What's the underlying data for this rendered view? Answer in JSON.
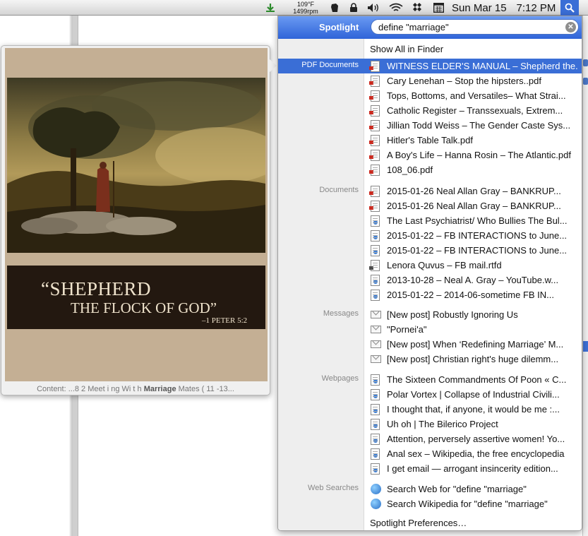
{
  "menubar": {
    "temp": "109°F",
    "rpm": "1499rpm",
    "day_date": "Sun Mar 15",
    "time": "7:12 PM"
  },
  "spotlight": {
    "label": "Spotlight",
    "query": "define \"marriage\"",
    "show_all": "Show All in Finder",
    "preferences": "Spotlight Preferences…"
  },
  "preview": {
    "cover_title_line1": "“SHEPHERD",
    "cover_title_line2": "THE FLOCK OF GOD”",
    "cover_reference": "–1 PETER 5:2",
    "content_prefix": "Content: ...8 2 Meet i ng Wi t h ",
    "content_match": "Marriage",
    "content_suffix": " Mates ( 11 -13..."
  },
  "categories": {
    "pdf": "PDF Documents",
    "documents": "Documents",
    "messages": "Messages",
    "webpages": "Webpages",
    "web_searches": "Web Searches"
  },
  "results": {
    "pdf": [
      "WITNESS ELDER'S MANUAL – Shepherd the...",
      "Cary Lenehan – Stop the hipsters..pdf",
      "Tops, Bottoms, and Versatiles– What Strai...",
      "Catholic Register – Transsexuals, Extrem...",
      "Jillian Todd Weiss – The Gender Caste Sys...",
      "Hitler's Table Talk.pdf",
      "A Boy's Life – Hanna Rosin – The Atlantic.pdf",
      "108_06.pdf"
    ],
    "documents": [
      "2015-01-26 Neal Allan Gray – BANKRUP...",
      "2015-01-26 Neal Allan Gray – BANKRUP...",
      "The Last Psychiatrist/ Who Bullies The Bul...",
      "2015-01-22 – FB INTERACTIONS to June...",
      "2015-01-22 – FB INTERACTIONS to June...",
      "Lenora Quvus – FB mail.rtfd",
      "2013-10-28 – Neal A. Gray – YouTube.w...",
      "2015-01-22 – 2014-06-sometime FB IN..."
    ],
    "messages": [
      "[New post] Robustly Ignoring Us",
      "\"Pornei'a\"",
      "[New post] When ‘Redefining Marriage’ M...",
      "[New post] Christian right's huge dilemm..."
    ],
    "webpages": [
      "The Sixteen Commandments Of Poon « C...",
      "Polar Vortex | Collapse of Industrial Civili...",
      "I thought that, if anyone, it would be me :...",
      "Uh oh | The Bilerico Project",
      "Attention, perversely assertive women! Yo...",
      "Anal sex – Wikipedia, the free encyclopedia",
      "I get email — arrogant insincerity edition..."
    ],
    "web_searches": [
      "Search Web for \"define \"marriage\"",
      "Search Wikipedia for \"define \"marriage\""
    ]
  },
  "colors": {
    "selection": "#3a6ed6",
    "header": "#2f64d8"
  }
}
